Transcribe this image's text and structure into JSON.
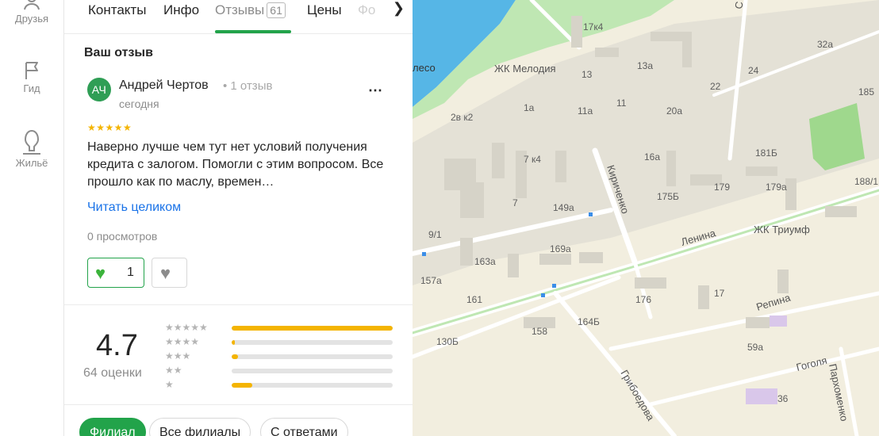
{
  "nav": {
    "items": [
      {
        "label": "Друзья",
        "icon": "friends-icon"
      },
      {
        "label": "Гид",
        "icon": "flag-icon"
      },
      {
        "label": "Жильё",
        "icon": "house-icon"
      }
    ]
  },
  "tabs": {
    "items": [
      "Контакты",
      "Инфо",
      "Отзывы",
      "Цены",
      "Фо"
    ],
    "reviews_count": "61",
    "active": "Отзывы"
  },
  "review": {
    "section_title": "Ваш отзыв",
    "avatar_initials": "АЧ",
    "author": "Андрей Чертов",
    "author_meta": "• 1 отзыв",
    "date": "сегодня",
    "stars": "★★★★★",
    "rating": 5,
    "text": "Наверно лучше чем тут нет условий получения кредита с залогом. Помогли с этим вопросом. Все прошло как по маслу, времен…",
    "read_more": "Читать целиком",
    "views": "0 просмотров",
    "likes": "1",
    "more_icon": "⋯"
  },
  "summary": {
    "rating": "4.7",
    "count": "64 оценки",
    "distribution": [
      {
        "stars": "★★★★★",
        "fraction": 1.0
      },
      {
        "stars": "★★★★",
        "fraction": 0.02
      },
      {
        "stars": "★★★",
        "fraction": 0.04
      },
      {
        "stars": "★★",
        "fraction": 0.0
      },
      {
        "stars": "★",
        "fraction": 0.13
      }
    ]
  },
  "filters": {
    "items": [
      "Филиал",
      "Все филиалы",
      "С ответами"
    ],
    "active": "Филиал"
  },
  "map": {
    "labels": {
      "leso": "лесо",
      "zhk_melodia": "ЖК Мелодия",
      "zhk_triumf": "ЖК Триумф",
      "street_kirichenko": "Кириченко",
      "street_lenina": "Ленина",
      "street_repina": "Репина",
      "street_gogolya": "Гоголя",
      "street_griboedova": "Грибоедова",
      "street_parkhomenko": "Пархоменко",
      "street_top": "С"
    },
    "house_numbers": [
      "17к4",
      "13а",
      "13",
      "22",
      "24",
      "32а",
      "185",
      "11а",
      "11",
      "20а",
      "2в к2",
      "1а",
      "16а",
      "181Б",
      "7 к4",
      "175Б",
      "179",
      "179а",
      "188/1",
      "7",
      "149а",
      "9/1",
      "169а",
      "163а",
      "157а",
      "161",
      "176",
      "17",
      "164Б",
      "158",
      "130Б",
      "59а",
      "36"
    ],
    "colors": {
      "land": "#f2eedf",
      "residential": "#e9e4cf",
      "building": "#d9d5c9",
      "water": "#56b6e6",
      "park": "#bfe7b3",
      "road": "#ffffff"
    }
  }
}
